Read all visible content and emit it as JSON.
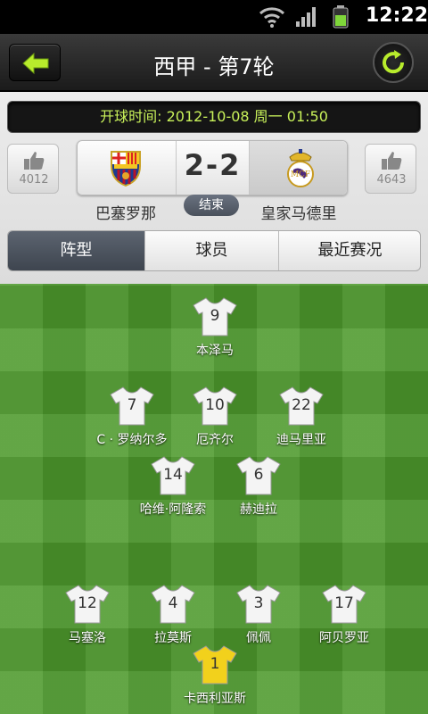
{
  "status_bar": {
    "time": "12:22"
  },
  "header": {
    "title": "西甲 - 第7轮"
  },
  "match": {
    "kickoff": "开球时间: 2012-10-08 周一 01:50",
    "home_likes": "4012",
    "away_likes": "4643",
    "score": "2-2",
    "status": "结束",
    "home_team": "巴塞罗那",
    "away_team": "皇家马德里"
  },
  "tabs": [
    "阵型",
    "球员",
    "最近赛况"
  ],
  "lineup": [
    {
      "number": "9",
      "name": "本泽马"
    },
    {
      "number": "7",
      "name": "C · 罗纳尔多"
    },
    {
      "number": "10",
      "name": "厄齐尔"
    },
    {
      "number": "22",
      "name": "迪马里亚"
    },
    {
      "number": "14",
      "name": "哈维·阿隆索"
    },
    {
      "number": "6",
      "name": "赫迪拉"
    },
    {
      "number": "12",
      "name": "马塞洛"
    },
    {
      "number": "4",
      "name": "拉莫斯"
    },
    {
      "number": "3",
      "name": "佩佩"
    },
    {
      "number": "17",
      "name": "阿贝罗亚"
    },
    {
      "number": "1",
      "name": "卡西利亚斯"
    }
  ],
  "colors": {
    "accent": "#a8e62a",
    "kickoff_text": "#c9f25a",
    "shirt": "#f4f4f4",
    "keeper_shirt": "#f2d11c"
  }
}
